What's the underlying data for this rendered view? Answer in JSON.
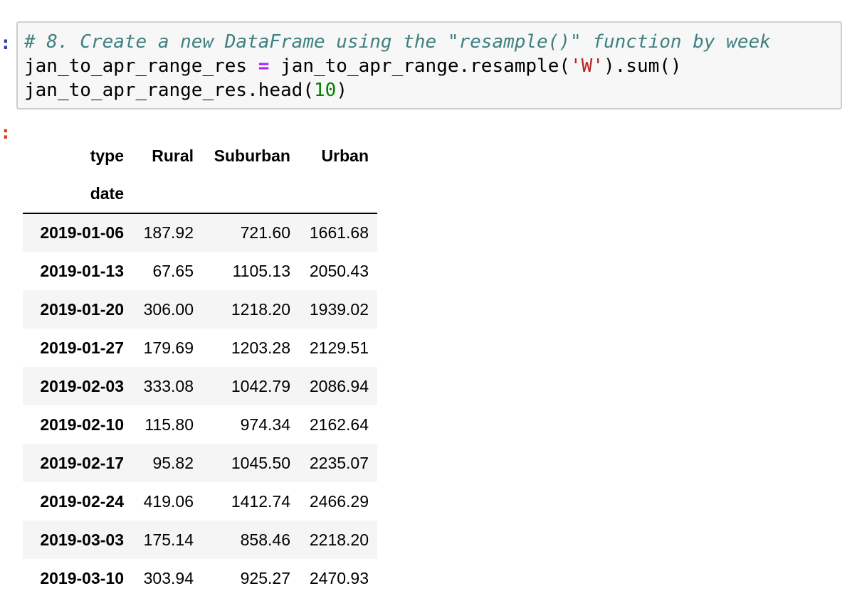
{
  "prompts": {
    "input_marker": ":",
    "output_marker": ":"
  },
  "code": {
    "comment": "# 8. Create a new DataFrame using the \"resample()\" function by week",
    "line2_var": "jan_to_apr_range_res ",
    "line2_op": "=",
    "line2_call_start": " jan_to_apr_range.resample(",
    "line2_str": "'W'",
    "line2_call_end": ").sum()",
    "line3_start": "jan_to_apr_range_res.head(",
    "line3_num": "10",
    "line3_end": ")"
  },
  "table": {
    "columns_name": "type",
    "index_name": "date",
    "columns": [
      "Rural",
      "Suburban",
      "Urban"
    ],
    "rows": [
      {
        "date": "2019-01-06",
        "rural": "187.92",
        "suburban": "721.60",
        "urban": "1661.68"
      },
      {
        "date": "2019-01-13",
        "rural": "67.65",
        "suburban": "1105.13",
        "urban": "2050.43"
      },
      {
        "date": "2019-01-20",
        "rural": "306.00",
        "suburban": "1218.20",
        "urban": "1939.02"
      },
      {
        "date": "2019-01-27",
        "rural": "179.69",
        "suburban": "1203.28",
        "urban": "2129.51"
      },
      {
        "date": "2019-02-03",
        "rural": "333.08",
        "suburban": "1042.79",
        "urban": "2086.94"
      },
      {
        "date": "2019-02-10",
        "rural": "115.80",
        "suburban": "974.34",
        "urban": "2162.64"
      },
      {
        "date": "2019-02-17",
        "rural": "95.82",
        "suburban": "1045.50",
        "urban": "2235.07"
      },
      {
        "date": "2019-02-24",
        "rural": "419.06",
        "suburban": "1412.74",
        "urban": "2466.29"
      },
      {
        "date": "2019-03-03",
        "rural": "175.14",
        "suburban": "858.46",
        "urban": "2218.20"
      },
      {
        "date": "2019-03-10",
        "rural": "303.94",
        "suburban": "925.27",
        "urban": "2470.93"
      }
    ]
  },
  "colors": {
    "input_prompt": "#303F9F",
    "output_prompt": "#D84315",
    "comment": "#408080",
    "operator": "#AA22FF",
    "string": "#BA2121",
    "number": "#008000",
    "cell_background": "#f7f7f7",
    "stripe": "#f5f5f5"
  }
}
